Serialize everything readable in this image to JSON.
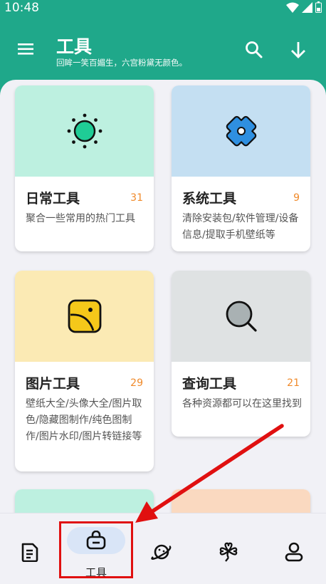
{
  "status_bar": {
    "time": "10:48"
  },
  "app_bar": {
    "title": "工具",
    "subtitle": "回眸一笑百媚生，六宫粉黛无颜色。"
  },
  "cards": [
    {
      "name": "日常工具",
      "count": "31",
      "description": "聚合一些常用的热门工具",
      "color": "#bdf0e0",
      "icon": "sun-icon"
    },
    {
      "name": "系统工具",
      "count": "9",
      "description": "清除安装包/软件管理/设备信息/提取手机壁纸等",
      "color": "#c4dff2",
      "icon": "gamepad-icon"
    },
    {
      "name": "图片工具",
      "count": "29",
      "description": "壁纸大全/头像大全/图片取色/隐藏图制作/纯色图制作/图片水印/图片转链接等",
      "color": "#fbeab4",
      "icon": "image-icon"
    },
    {
      "name": "查询工具",
      "count": "21",
      "description": "各种资源都可以在这里找到",
      "color": "#dfe2e3",
      "icon": "search-magnifier-icon"
    }
  ],
  "bottom_nav": {
    "items": [
      {
        "name": "document",
        "icon": "document-icon"
      },
      {
        "name": "tools",
        "icon": "toolbox-icon",
        "label": "工具",
        "active": true
      },
      {
        "name": "planet",
        "icon": "planet-icon"
      },
      {
        "name": "clover",
        "icon": "clover-icon"
      },
      {
        "name": "profile",
        "icon": "person-icon"
      }
    ]
  },
  "colors": {
    "primary": "#1fa88a",
    "accent_count": "#f08a2a",
    "annotation_red": "#e01010"
  }
}
